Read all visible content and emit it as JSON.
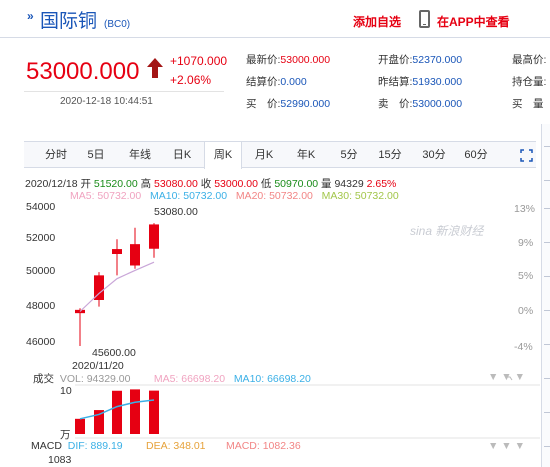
{
  "header": {
    "title": "国际铜",
    "code": "(BC0)",
    "add_fav": "添加自选",
    "app_link": "在APP中查看"
  },
  "quote": {
    "price": "53000.000",
    "change": "+1070.000",
    "change_pct": "+2.06%",
    "datetime": "2020-12-18 10:44:51",
    "col1": [
      {
        "label": "最新价:",
        "value": "53000.000",
        "tone": "red"
      },
      {
        "label": "结算价:",
        "value": "0.000",
        "tone": "blue"
      },
      {
        "label": "买　价:",
        "value": "52990.000",
        "tone": "blue"
      }
    ],
    "col2": [
      {
        "label": "开盘价:",
        "value": "52370.000",
        "tone": "blue"
      },
      {
        "label": "昨结算:",
        "value": "51930.000",
        "tone": "blue"
      },
      {
        "label": "卖　价:",
        "value": "53000.000",
        "tone": "blue"
      }
    ],
    "col3": [
      "最高价:",
      "持仓量:",
      "买　量"
    ]
  },
  "tabs": [
    "分时",
    "5日",
    "年线",
    "日K",
    "周K",
    "月K",
    "年K",
    "5分",
    "15分",
    "30分",
    "60分"
  ],
  "active_tab": "周K",
  "kline_info": {
    "date": "2020/12/18",
    "open_label": "开",
    "open": "51520.00",
    "high_label": "高",
    "high": "53080.00",
    "close_label": "收",
    "close": "53000.00",
    "low_label": "低",
    "low": "50970.00",
    "vol_label": "量",
    "vol": "94329",
    "pct": "2.65%"
  },
  "ma_line": {
    "ma5": "MA5: 50732.00",
    "ma10": "MA10: 50732.00",
    "ma20": "MA20: 50732.00",
    "ma30": "MA30: 50732.00"
  },
  "colors": {
    "up": "#e60012",
    "ma5": "#f0a3c0",
    "ma10": "#3bb0e6",
    "ma20": "#f28585",
    "ma30": "#a2c64a"
  },
  "chart_data": {
    "type": "candlestick",
    "y_labels": [
      "54000",
      "52000",
      "50000",
      "48000",
      "46000"
    ],
    "ylim": [
      45600,
      54200
    ],
    "pct_labels": [
      "13%",
      "9%",
      "5%",
      "0%",
      "-4%"
    ],
    "max_label": "53080.00",
    "min_label": "45600.00",
    "x_label": "2020/11/20",
    "candles": [
      {
        "open": 47600,
        "close": 47800,
        "high": 47900,
        "low": 45600
      },
      {
        "open": 48400,
        "close": 49900,
        "high": 50100,
        "low": 48000
      },
      {
        "open": 51200,
        "close": 51500,
        "high": 52100,
        "low": 49900
      },
      {
        "open": 50500,
        "close": 51800,
        "high": 52800,
        "low": 50300
      },
      {
        "open": 51520,
        "close": 53000,
        "high": 53080,
        "low": 50970
      }
    ],
    "ma_line": [
      47700,
      48800,
      49700,
      50200,
      50700
    ],
    "volume": {
      "label": "成交",
      "vol_text": "VOL: 94329.00",
      "ma5_text": "MA5: 66698.20",
      "ma10_text": "MA10: 66698.20",
      "scale_top": "10",
      "unit": "万",
      "bars": [
        33000,
        52000,
        94000,
        97000,
        94329
      ],
      "max": 100000,
      "ma_line": [
        33000,
        42500,
        59600,
        69000,
        74000
      ]
    },
    "macd": {
      "label": "MACD",
      "dif": "DIF: 889.19",
      "dea": "DEA: 348.01",
      "macd": "MACD: 1082.36",
      "scale_top": "1083"
    }
  }
}
